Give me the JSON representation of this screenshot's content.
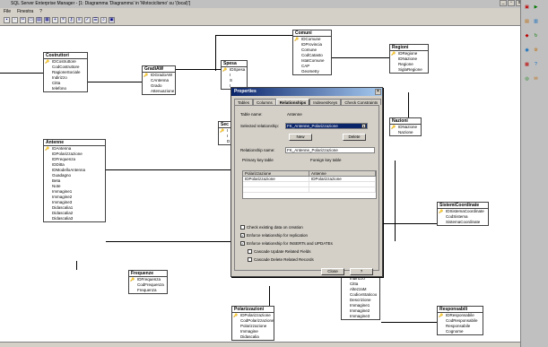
{
  "window": {
    "title": "SQL Server Enterprise Manager - [1: Diagramma 'Diagramma' in 'Motociclismo' su '(local)']",
    "min": "_",
    "restore": "▫",
    "close": "x"
  },
  "menu": [
    "File",
    "Finestra",
    "?"
  ],
  "toolbar_icons": [
    "save-icon",
    "print-icon",
    "cut-icon",
    "copy-icon",
    "paste-icon",
    "new-table-icon",
    "add-table-icon",
    "delete-icon",
    "relationship-icon",
    "index-icon",
    "constraint-icon",
    "properties-icon",
    "zoom-icon",
    "layout-icon"
  ],
  "tables": {
    "costruttori": {
      "title": "Costruttori",
      "rows": [
        "IDCostruttore",
        "CodCostruttore",
        "RagioneSociale",
        "Indirizzo",
        "Citta",
        "telefono"
      ]
    },
    "gradiaw": {
      "title": "GradiAW",
      "rows": [
        "IDGradoAW",
        "CAntenna",
        "Grado",
        "Attenuazione"
      ]
    },
    "spesa": {
      "title": "Spesa",
      "rows": [
        "IDSpesa",
        "I",
        "S",
        "I"
      ]
    },
    "comuni": {
      "title": "Comuni",
      "rows": [
        "IDComune",
        "IDProvincia",
        "Comune",
        "CodCatasto",
        "IstatComune",
        "CAP",
        "Geometry"
      ]
    },
    "regioni": {
      "title": "Regioni",
      "rows": [
        "IDRegione",
        "IDNazione",
        "Regione",
        "SiglaRegione"
      ]
    },
    "nazioni": {
      "title": "Nazioni",
      "rows": [
        "IDNazione",
        "Nazione"
      ]
    },
    "antenne": {
      "title": "Antenne",
      "rows": [
        "IDAntenna",
        "IDPolarizzazione",
        "IDFrequenza",
        "IDDitta",
        "IDModelloAntenna",
        "Guadagno",
        "Beta",
        "Note",
        "Immagine1",
        "Immagine2",
        "Immagine3",
        "Didascalia1",
        "Didascalia2",
        "Didascalia3"
      ]
    },
    "frequenze": {
      "title": "Frequenze",
      "rows": [
        "IDFrequenza",
        "CodFrequenza",
        "Frequenza"
      ]
    },
    "polarizzazioni": {
      "title": "Polarizzazioni",
      "rows": [
        "IDPolarizzazione",
        "CodPolarizzazione",
        "Polarizzazione",
        "Immagine",
        "Didascalia"
      ]
    },
    "siti": {
      "title": "",
      "rows": [
        "Indirizzo",
        "Citta",
        "AltezzaM",
        "CodiceStaticoo",
        "Descrizione",
        "Immagine1",
        "Immagine2",
        "Immagine3"
      ]
    },
    "sistemicoordinate": {
      "title": "SistemiCoordinate",
      "rows": [
        "IDSistemaCoordinate",
        "CodSistema",
        "SistemaCoordinate"
      ]
    },
    "responsabili": {
      "title": "Responsabili",
      "rows": [
        "IDResponsabile",
        "CodResponsabile",
        "Responsabile",
        "Cognome"
      ]
    },
    "sec": {
      "title": "Sec",
      "rows": [
        "I",
        "I",
        "D"
      ]
    }
  },
  "dialog": {
    "title": "Properties",
    "tabs": [
      "Tables",
      "Columns",
      "Relationships",
      "Indexes/Keys",
      "Check Constraints"
    ],
    "table_name_label": "Table name:",
    "table_name_value": "Antenne",
    "selected_rel_label": "Selected relationship:",
    "selected_rel_value": "FK_Antenne_Polarizzazione",
    "new_label": "New",
    "delete_label": "Delete",
    "rel_name_label": "Relationship name:",
    "rel_name_value": "FK_Antenne_Polarizzazione",
    "pk_table_label": "Primary key table",
    "fk_table_label": "Foreign key table",
    "pk_table_value": "Polarizzazione",
    "fk_table_value": "Antenne",
    "pk_col": "IDPolarizzazione",
    "fk_col": "IDPolarizzazione",
    "chk1": "Check existing data on creation",
    "chk2": "Enforce relationship for replication",
    "chk3": "Enforce relationship for INSERTs and UPDATEs",
    "chk4": "Cascade Update Related Fields",
    "chk5": "Cascade Delete Related Records",
    "close_label": "Close",
    "help_label": "?"
  }
}
